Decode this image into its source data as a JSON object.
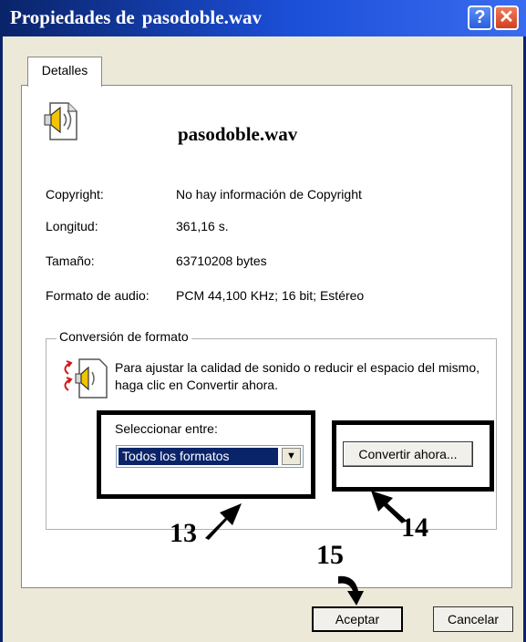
{
  "window": {
    "title_prefix": "Propiedades de",
    "title_file": "pasodoble.wav",
    "help_label": "?",
    "close_label": "✕"
  },
  "tabs": [
    {
      "label": "Detalles"
    }
  ],
  "file": {
    "name": "pasodoble.wav",
    "icon": "speaker-file-icon"
  },
  "properties": [
    {
      "label": "Copyright:",
      "value": "No hay información de Copyright"
    },
    {
      "label": "Longitud:",
      "value": "361,16 s."
    },
    {
      "label": "Tamaño:",
      "value": "63710208 bytes"
    },
    {
      "label": "Formato de audio:",
      "value": "PCM 44,100 KHz; 16 bit; Estéreo"
    }
  ],
  "conversion": {
    "group_label": "Conversión de formato",
    "description": "Para ajustar la calidad de sonido o reducir el espacio del mismo, haga clic en Convertir ahora.",
    "select_label": "Seleccionar entre:",
    "select_value": "Todos los formatos",
    "convert_button": "Convertir ahora..."
  },
  "footer": {
    "ok_label": "Aceptar",
    "cancel_label": "Cancelar"
  },
  "annotations": {
    "callout_13": "13",
    "callout_14": "14",
    "callout_15": "15"
  },
  "colors": {
    "titlebar": "#0a246a",
    "selection": "#0a246a",
    "window_bg": "#ece9d8"
  }
}
